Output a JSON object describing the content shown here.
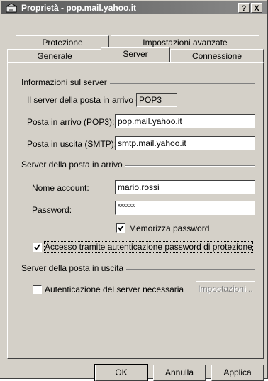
{
  "window": {
    "title": "Proprietà - pop.mail.yahoo.it",
    "help_label": "?",
    "close_label": "X"
  },
  "tabs": {
    "row1": [
      {
        "label": "Protezione"
      },
      {
        "label": "Impostazioni avanzate"
      }
    ],
    "row2": [
      {
        "label": "Generale"
      },
      {
        "label": "Server",
        "active": true
      },
      {
        "label": "Connessione"
      }
    ]
  },
  "server_info": {
    "group_title": "Informazioni sul server",
    "incoming_type_label": "Il server della posta in arrivo è:",
    "incoming_type_value": "POP3",
    "incoming_label": "Posta in arrivo (POP3):",
    "incoming_value": "pop.mail.yahoo.it",
    "outgoing_label": "Posta in uscita (SMTP):",
    "outgoing_value": "smtp.mail.yahoo.it"
  },
  "incoming_server": {
    "group_title": "Server della posta in arrivo",
    "account_label": "Nome account:",
    "account_value": "mario.rossi",
    "password_label": "Password:",
    "password_value": "xxxxxx",
    "remember_label": "Memorizza password",
    "remember_checked": true,
    "spa_label": "Accesso tramite autenticazione password di protezione",
    "spa_checked": true
  },
  "outgoing_server": {
    "group_title": "Server della posta in uscita",
    "auth_label": "Autenticazione del server necessaria",
    "auth_checked": false,
    "settings_button": "Impostazioni..."
  },
  "footer": {
    "ok_label": "OK",
    "cancel_label": "Annulla",
    "apply_label": "Applica"
  }
}
